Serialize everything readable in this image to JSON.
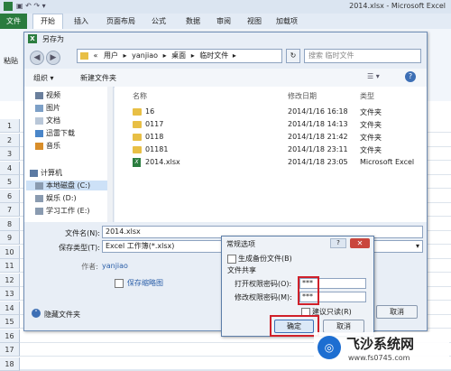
{
  "excel": {
    "window_title": "2014.xlsx - Microsoft Excel",
    "tabs": [
      "文件",
      "开始",
      "插入",
      "页面布局",
      "公式",
      "数据",
      "审阅",
      "视图",
      "加载项"
    ],
    "ribbon_left_label": "粘贴",
    "row_numbers": [
      "1",
      "2",
      "3",
      "4",
      "5",
      "6",
      "7",
      "8",
      "9",
      "10",
      "11",
      "12",
      "13",
      "14",
      "15",
      "16",
      "17",
      "18"
    ]
  },
  "save_dialog": {
    "title": "另存为",
    "address_parts": [
      "«",
      "用户",
      "yanjiao",
      "桌面",
      "临时文件"
    ],
    "search_placeholder": "搜索 临时文件",
    "toolbar": {
      "organize": "组织 ▾",
      "new_folder": "新建文件夹"
    },
    "nav_items": [
      "视频",
      "图片",
      "文档",
      "迅雷下载",
      "音乐",
      "计算机",
      "本地磁盘 (C:)",
      "娱乐 (D:)",
      "学习工作 (E:)"
    ],
    "columns": {
      "name": "名称",
      "date": "修改日期",
      "type": "类型"
    },
    "files": [
      {
        "name": "16",
        "date": "2014/1/16 16:18",
        "type": "文件夹",
        "kind": "folder"
      },
      {
        "name": "0117",
        "date": "2014/1/18 14:13",
        "type": "文件夹",
        "kind": "folder"
      },
      {
        "name": "0118",
        "date": "2014/1/18 21:42",
        "type": "文件夹",
        "kind": "folder"
      },
      {
        "name": "01181",
        "date": "2014/1/18 23:11",
        "type": "文件夹",
        "kind": "folder"
      },
      {
        "name": "2014.xlsx",
        "date": "2014/1/18 23:05",
        "type": "Microsoft Excel",
        "kind": "xlsx"
      }
    ],
    "filename_label": "文件名(N):",
    "filename_value": "2014.xlsx",
    "filetype_label": "保存类型(T):",
    "filetype_value": "Excel 工作簿(*.xlsx)",
    "author_label": "作者:",
    "author_value": "yanjiao",
    "thumbnail_label": "保存缩略图",
    "hide_folders": "隐藏文件夹",
    "cancel_label": "取消"
  },
  "options_dialog": {
    "title": "常规选项",
    "backup_label": "生成备份文件(B)",
    "sharing_label": "文件共享",
    "open_pwd_label": "打开权限密码(O):",
    "open_pwd_value": "***",
    "modify_pwd_label": "修改权限密码(M):",
    "modify_pwd_value": "***",
    "readonly_label": "建议只读(R)",
    "ok_label": "确定",
    "cancel_label": "取消"
  },
  "watermark": {
    "name": "飞沙系统网",
    "url": "www.fs0745.com"
  },
  "colors": {
    "excel_green": "#2b7d3f",
    "highlight_red": "#d0202a",
    "folder_yellow": "#e8bf45"
  }
}
